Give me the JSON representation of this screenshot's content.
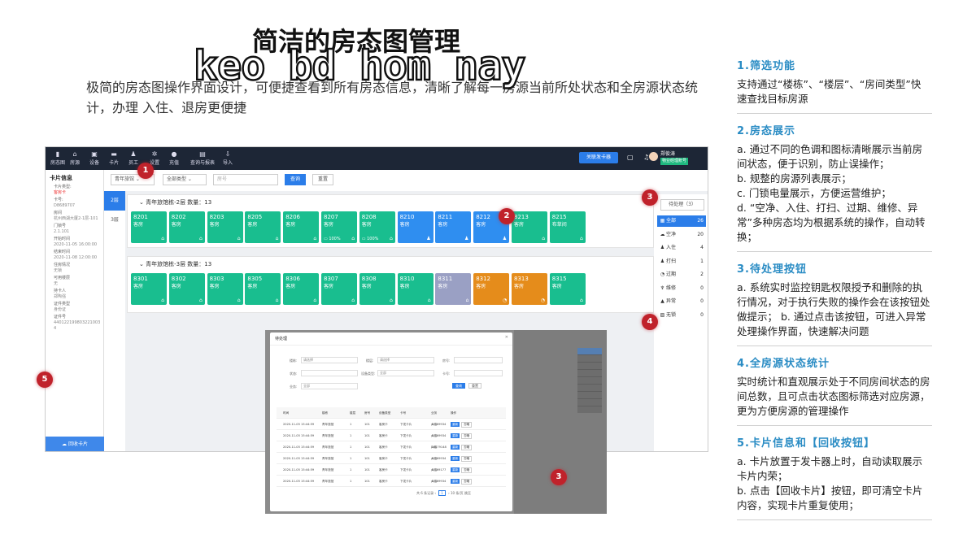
{
  "headline": "简洁的房态图管理",
  "watermark": "keo bd hom nay",
  "intro": "极简的房态图操作界面设计，可便捷查看到所有房态信息，清晰了解每一房源当前所处状态和全房源状态统计，办理 入住、退房更便捷",
  "app": {
    "nav": [
      {
        "icon": "building-icon",
        "glyph": "▮",
        "label": "房态图"
      },
      {
        "icon": "home-icon",
        "glyph": "⌂",
        "label": "房源"
      },
      {
        "icon": "device-icon",
        "glyph": "▣",
        "label": "设备"
      },
      {
        "icon": "card-icon",
        "glyph": "▬",
        "label": "卡片"
      },
      {
        "icon": "staff-icon",
        "glyph": "♟",
        "label": "员工"
      },
      {
        "icon": "settings-icon",
        "glyph": "✲",
        "label": "设置"
      },
      {
        "icon": "recharge-icon",
        "glyph": "●",
        "label": "充值"
      },
      {
        "icon": "report-icon",
        "glyph": "▤",
        "label": "查询与报表"
      },
      {
        "icon": "import-icon",
        "glyph": "⇩",
        "label": "导入"
      }
    ],
    "send_card_label": "关联发卡器",
    "user_name": "郑俊涛",
    "user_badge": "物业经理账号"
  },
  "card_panel": {
    "title": "卡片信息",
    "fields": [
      {
        "label": "卡片类型:",
        "value": "客房卡",
        "red": true
      },
      {
        "label": "卡号:",
        "value": "D8689707"
      },
      {
        "label": "房间",
        "value": "杭州西湖大厦2-1层-101"
      },
      {
        "label": "门锁号",
        "value": "2.1.101"
      },
      {
        "label": "开始时间",
        "value": "2020-11-05 16:00:00"
      },
      {
        "label": "结束时间",
        "value": "2020-11-08 12:00:00"
      },
      {
        "label": "住房情况",
        "value": "无锁"
      },
      {
        "label": "可用楼层",
        "value": "无"
      },
      {
        "label": "持卡人",
        "value": "郑陶强"
      },
      {
        "label": "证件类型",
        "value": "身份证"
      },
      {
        "label": "证件号",
        "value": "440122199803221003 4"
      }
    ],
    "recycle_label": "回收卡片"
  },
  "filters": {
    "building": "青年旅馆",
    "type": "全部类型",
    "room_placeholder": "房号",
    "query_label": "查询",
    "reset_label": "重置"
  },
  "floor_tabs": [
    "2层",
    "3层"
  ],
  "floors": [
    {
      "title": "青年旅馆栋-2层 数量：13",
      "rooms": [
        {
          "no": "8201",
          "status": "客房",
          "color": "green",
          "icon": "⌂",
          "battery": ""
        },
        {
          "no": "8202",
          "status": "客房",
          "color": "green",
          "icon": "⌂",
          "battery": ""
        },
        {
          "no": "8203",
          "status": "客房",
          "color": "green",
          "icon": "⌂",
          "battery": ""
        },
        {
          "no": "8205",
          "status": "客房",
          "color": "green",
          "icon": "⌂",
          "battery": ""
        },
        {
          "no": "8206",
          "status": "客房",
          "color": "green",
          "icon": "⌂",
          "battery": ""
        },
        {
          "no": "8207",
          "status": "客房",
          "color": "green",
          "icon": "⌂",
          "battery": "100%"
        },
        {
          "no": "8208",
          "status": "客房",
          "color": "green",
          "icon": "⌂",
          "battery": "100%"
        },
        {
          "no": "8210",
          "status": "客房",
          "color": "blue",
          "icon": "♟",
          "battery": ""
        },
        {
          "no": "8211",
          "status": "客房",
          "color": "blue",
          "icon": "♟",
          "battery": ""
        },
        {
          "no": "8212",
          "status": "客房",
          "color": "blue",
          "icon": "♟",
          "battery": ""
        },
        {
          "no": "8213",
          "status": "客房",
          "color": "green",
          "icon": "⌂",
          "battery": ""
        },
        {
          "no": "8215",
          "status": "布草间",
          "color": "green",
          "icon": "⌂",
          "battery": ""
        }
      ]
    },
    {
      "title": "青年旅馆栋-3层 数量：13",
      "rooms": [
        {
          "no": "8301",
          "status": "客房",
          "color": "green",
          "icon": "⌂",
          "battery": ""
        },
        {
          "no": "8302",
          "status": "客房",
          "color": "green",
          "icon": "⌂",
          "battery": ""
        },
        {
          "no": "8303",
          "status": "客房",
          "color": "green",
          "icon": "⌂",
          "battery": ""
        },
        {
          "no": "8305",
          "status": "客房",
          "color": "green",
          "icon": "⌂",
          "battery": ""
        },
        {
          "no": "8306",
          "status": "客房",
          "color": "green",
          "icon": "⌂",
          "battery": ""
        },
        {
          "no": "8307",
          "status": "客房",
          "color": "green",
          "icon": "⌂",
          "battery": ""
        },
        {
          "no": "8308",
          "status": "客房",
          "color": "green",
          "icon": "⌂",
          "battery": ""
        },
        {
          "no": "8310",
          "status": "客房",
          "color": "green",
          "icon": "⌂",
          "battery": ""
        },
        {
          "no": "8311",
          "status": "客房",
          "color": "gray",
          "icon": "⌂",
          "battery": ""
        },
        {
          "no": "8312",
          "status": "客房",
          "color": "orange",
          "icon": "◔",
          "battery": ""
        },
        {
          "no": "8313",
          "status": "客房",
          "color": "orange",
          "icon": "◔",
          "battery": ""
        },
        {
          "no": "8315",
          "status": "客房",
          "color": "green",
          "icon": "⌂",
          "battery": ""
        }
      ]
    }
  ],
  "status_panel": {
    "pending_label": "待处理（3）",
    "items": [
      {
        "icon": "grid-icon",
        "glyph": "▦",
        "label": "全部",
        "count": "26",
        "active": true
      },
      {
        "icon": "vacant-icon",
        "glyph": "☁",
        "label": "空净",
        "count": "20"
      },
      {
        "icon": "checkin-icon",
        "glyph": "♟",
        "label": "入住",
        "count": "4"
      },
      {
        "icon": "clean-icon",
        "glyph": "♟",
        "label": "打扫",
        "count": "1"
      },
      {
        "icon": "expired-icon",
        "glyph": "◔",
        "label": "过期",
        "count": "2"
      },
      {
        "icon": "repair-icon",
        "glyph": "♆",
        "label": "维修",
        "count": "0"
      },
      {
        "icon": "abnormal-icon",
        "glyph": "▲",
        "label": "异常",
        "count": "0"
      },
      {
        "icon": "noroom-icon",
        "glyph": "▨",
        "label": "无锁",
        "count": "0"
      }
    ]
  },
  "modal": {
    "title": "待处理",
    "table_header": [
      "时间",
      "楼栋",
      "楼层",
      "房号",
      "设备类型",
      "卡号",
      "业务",
      "操作"
    ],
    "rows": [
      [
        "2020-11-05 15:44:59",
        "青年旅馆",
        "1",
        "101",
        "客房卡",
        "下发卡片",
        "40469934",
        "入住"
      ],
      [
        "2020-11-05 15:44:59",
        "青年旅馆",
        "1",
        "101",
        "客房卡",
        "下发卡片",
        "40469934",
        "入住"
      ],
      [
        "2020-11-05 15:44:59",
        "青年旅馆",
        "1",
        "101",
        "客房卡",
        "下发卡片",
        "D8679148",
        "入住"
      ],
      [
        "2020-11-05 15:44:59",
        "青年旅馆",
        "1",
        "101",
        "客房卡",
        "下发卡片",
        "40469934",
        "入住"
      ],
      [
        "2020-11-05 15:44:59",
        "青年旅馆",
        "1",
        "101",
        "客房卡",
        "下发卡片",
        "40469177",
        "入住"
      ],
      [
        "2020-11-05 15:44:59",
        "青年旅馆",
        "1",
        "101",
        "客房卡",
        "下发卡片",
        "40469934",
        "入住"
      ]
    ],
    "op_primary": "重新",
    "op_secondary": "忽略",
    "pager_total": "共 6 条记录",
    "pager_page": "1",
    "pager_size": "10 条/页",
    "pager_goto": "跳至"
  },
  "markers": [
    "1",
    "2",
    "3",
    "4",
    "5",
    "3"
  ],
  "sidebar": [
    {
      "title": "1.筛选功能",
      "lines": [
        "支持通过“楼栋”、“楼层”、“房间类型”快 速查找目标房源"
      ]
    },
    {
      "title": "2.房态展示",
      "lines": [
        "a. 通过不同的色调和图标清晰展示当前房间状态，便于识别，防止误操作；",
        "b. 规整的房源列表展示；",
        "c. 门锁电量展示，方便运营维护；",
        "d. “空净、入住、打扫、过期、维修、异常”多种房态均为根据系统的操作，自动转换；"
      ]
    },
    {
      "title": "3.待处理按钮",
      "lines": [
        "a. 系统实时监控钥匙权限授予和删除的执行情况，对于执行失败的操作会在该按钮处做提示； b. 通过点击该按钮，可进入异常处理操作界面，快速解决问题"
      ]
    },
    {
      "title": "4.全房源状态统计",
      "lines": [
        "实时统计和直观展示处于不同房间状态的房间总数，且可点击状态图标筛选对应房源，更为方便房源的管理操作"
      ]
    },
    {
      "title": "5.卡片信息和【回收按钮】",
      "lines": [
        "a. 卡片放置于发卡器上时，自动读取展示卡片内荣；",
        "b. 点击【回收卡片】按钮，即可清空卡片内容，实现卡片重复使用；"
      ]
    }
  ]
}
